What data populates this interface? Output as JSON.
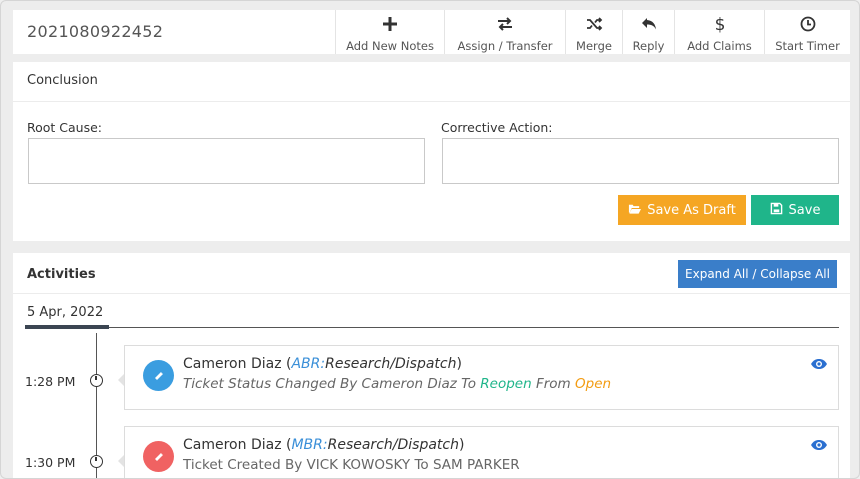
{
  "header": {
    "ticket_id": "2021080922452",
    "toolbar": [
      {
        "label": "Add New Notes",
        "icon": "plus-icon"
      },
      {
        "label": "Assign / Transfer",
        "icon": "transfer-icon"
      },
      {
        "label": "Merge",
        "icon": "shuffle-icon"
      },
      {
        "label": "Reply",
        "icon": "reply-icon"
      },
      {
        "label": "Add Claims",
        "icon": "dollar-icon"
      },
      {
        "label": "Start Timer",
        "icon": "clock-icon"
      }
    ]
  },
  "conclusion": {
    "title": "Conclusion",
    "root_cause_label": "Root Cause:",
    "root_cause_value": "",
    "corrective_action_label": "Corrective Action:",
    "corrective_action_value": "",
    "save_draft_label": "Save As Draft",
    "save_label": "Save"
  },
  "activities": {
    "title": "Activities",
    "expand_collapse_label": "Expand All / Collapse All",
    "date": "5 Apr, 2022",
    "entries": [
      {
        "time": "1:28 PM",
        "avatar_color": "#3a9de0",
        "name": "Cameron Diaz",
        "code": "ABR:",
        "role": "Research/Dispatch",
        "desc_pre": "Ticket Status Changed By Cameron Diaz To",
        "status_to": "Reopen",
        "desc_mid": "From",
        "status_from": "Open"
      },
      {
        "time": "1:30 PM",
        "avatar_color": "#f06262",
        "name": "Cameron Diaz",
        "code": "MBR:",
        "role": "Research/Dispatch",
        "desc": "Ticket Created By VICK KOWOSKY To SAM PARKER"
      }
    ]
  },
  "colors": {
    "draft": "#f5a623",
    "save": "#1fb58a",
    "primary": "#3a7ec9",
    "link": "#3a8fd8"
  }
}
